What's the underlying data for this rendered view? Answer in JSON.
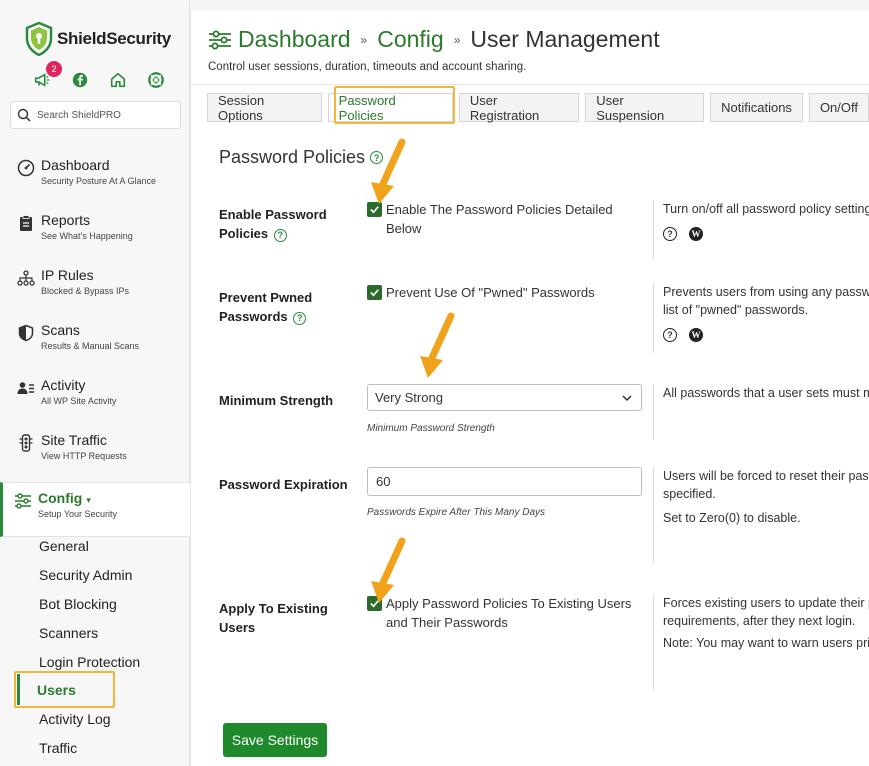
{
  "app": {
    "logo_text": "ShieldSecurity"
  },
  "notifications": {
    "count": "2"
  },
  "search": {
    "placeholder": "Search ShieldPRO"
  },
  "sidebar": {
    "items": [
      {
        "title": "Dashboard",
        "sub": "Security Posture At A Glance"
      },
      {
        "title": "Reports",
        "sub": "See What's Happening"
      },
      {
        "title": "IP Rules",
        "sub": "Blocked & Bypass IPs"
      },
      {
        "title": "Scans",
        "sub": "Results & Manual Scans"
      },
      {
        "title": "Activity",
        "sub": "All WP Site Activity"
      },
      {
        "title": "Site Traffic",
        "sub": "View HTTP Requests"
      },
      {
        "title": "Config",
        "sub": "Setup Your Security"
      }
    ],
    "config_caret": "▾",
    "sub_items": [
      "General",
      "Security Admin",
      "Bot Blocking",
      "Scanners",
      "Login Protection",
      "Users",
      "Activity Log",
      "Traffic"
    ]
  },
  "header": {
    "breadcrumb": [
      "Dashboard",
      "Config",
      "User Management"
    ],
    "separator": "»",
    "description": "Control user sessions, duration, timeouts and account sharing."
  },
  "tabs": [
    "Session Options",
    "Password Policies",
    "User Registration",
    "User Suspension",
    "Notifications",
    "On/Off"
  ],
  "section": {
    "title": "Password Policies"
  },
  "options": {
    "enable": {
      "label": "Enable Password Policies",
      "checkbox_label": "Enable The Password Policies Detailed Below",
      "desc": "Turn on/off all password policy settings."
    },
    "pwned": {
      "label": "Prevent Pwned Passwords",
      "checkbox_label": "Prevent Use Of \"Pwned\" Passwords",
      "desc1": "Prevents users from using any passwords found on the public",
      "desc2": "list of \"pwned\" passwords."
    },
    "strength": {
      "label": "Minimum Strength",
      "value": "Very Strong",
      "hint": "Minimum Password Strength",
      "desc": "All passwords that a user sets must meet this minimum strength."
    },
    "expiration": {
      "label": "Password Expiration",
      "value": "60",
      "hint": "Passwords Expire After This Many Days",
      "desc1": "Users will be forced to reset their passwords after the number of days",
      "desc2": "specified.",
      "desc3": "Set to Zero(0) to disable."
    },
    "existing": {
      "label": "Apply To Existing Users",
      "checkbox_label": "Apply Password Policies To Existing Users and Their Passwords",
      "desc1": "Forces existing users to update their passwords if they don't meet",
      "desc2": "requirements, after they next login.",
      "desc3": "Note: You may want to warn users prior to enabling this option."
    }
  },
  "save_label": "Save Settings",
  "colors": {
    "brand": "#2b8a3e",
    "highlight": "#f4b63a",
    "arrow": "#f0a21a",
    "badge": "#e0245e"
  }
}
